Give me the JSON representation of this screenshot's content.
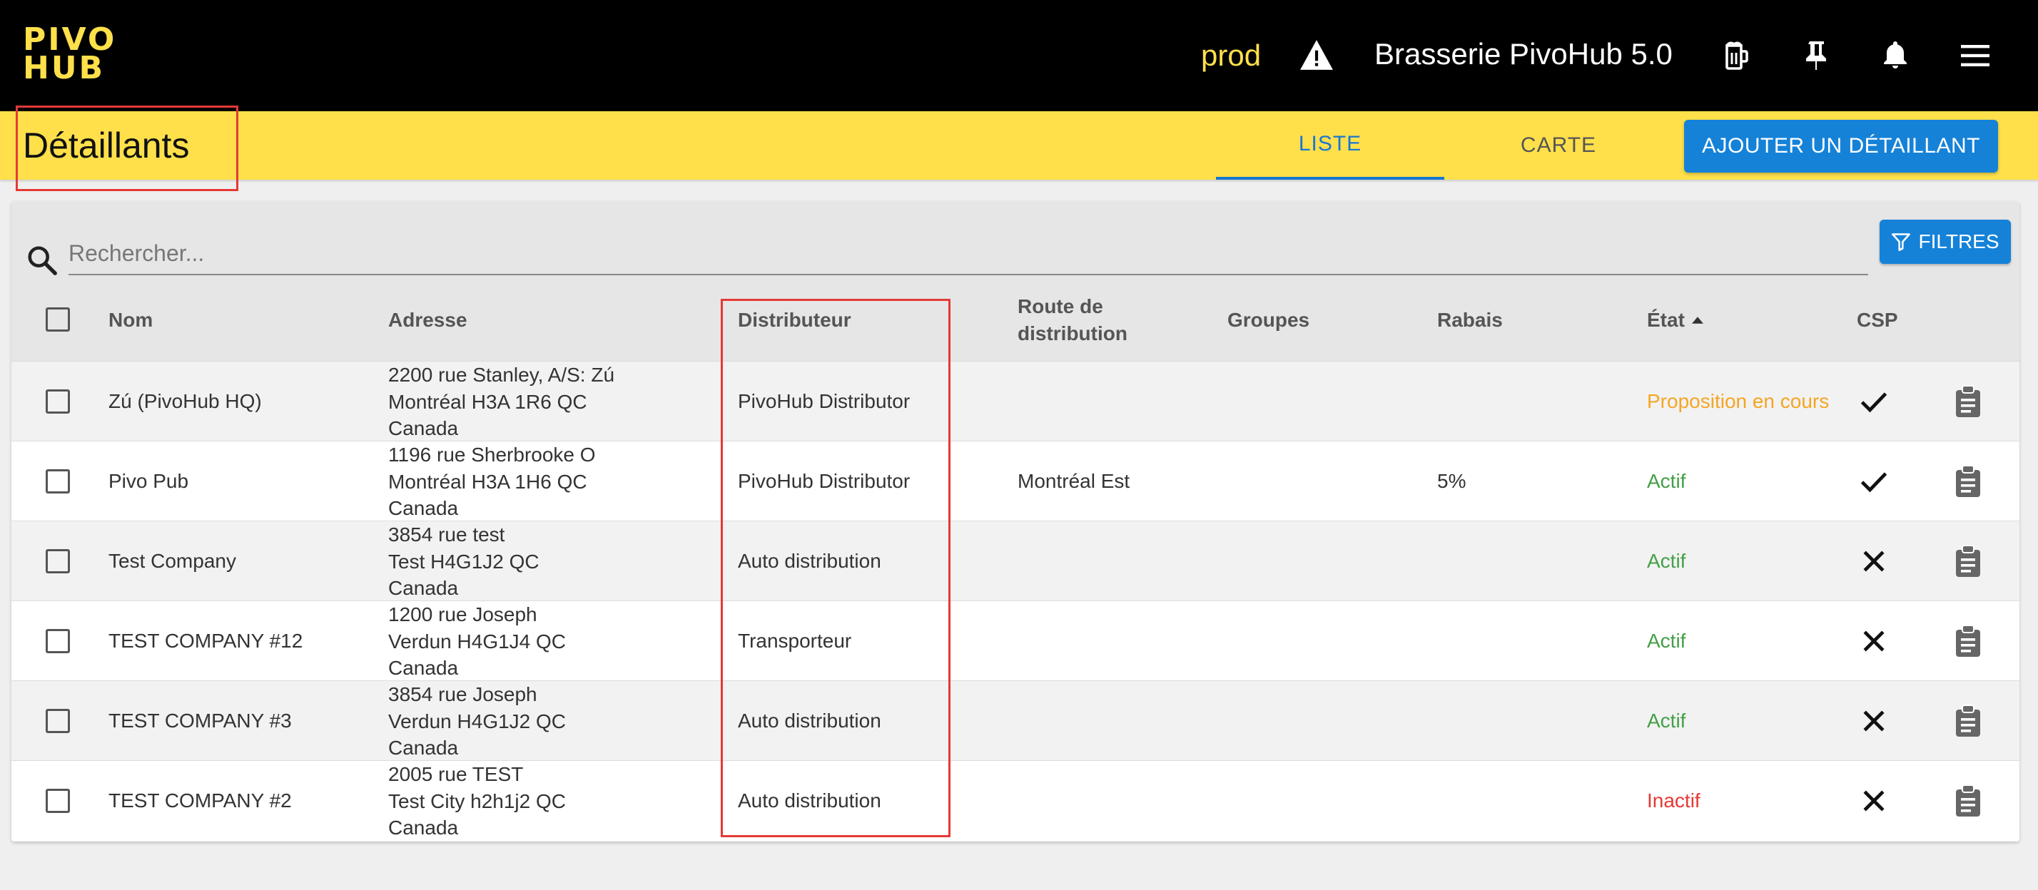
{
  "topbar": {
    "logo_line1": "PIVO",
    "logo_line2": "HUB",
    "env": "prod",
    "brewery": "Brasserie PivoHub 5.0",
    "icons": [
      "warning-icon",
      "beer-icon",
      "pin-icon",
      "bell-icon",
      "menu-icon"
    ]
  },
  "header": {
    "title": "Détaillants",
    "tabs": [
      {
        "label": "LISTE",
        "active": true
      },
      {
        "label": "CARTE",
        "active": false
      }
    ],
    "add_button": "AJOUTER UN DÉTAILLANT"
  },
  "search": {
    "placeholder": "Rechercher...",
    "filters_label": "FILTRES"
  },
  "table": {
    "columns": {
      "name": "Nom",
      "address": "Adresse",
      "distributor": "Distributeur",
      "route_line1": "Route de",
      "route_line2": "distribution",
      "groups": "Groupes",
      "discount": "Rabais",
      "state": "État",
      "csp": "CSP"
    },
    "sort": {
      "column": "state",
      "direction": "ascending"
    },
    "rows": [
      {
        "name": "Zú (PivoHub HQ)",
        "address": [
          "2200 rue Stanley, A/S: Zú",
          "Montréal H3A 1R6 QC",
          "Canada"
        ],
        "distributor": "PivoHub Distributor",
        "route": "",
        "groups": "",
        "discount": "",
        "state": "Proposition en cours",
        "state_color": "#f5a524",
        "csp": true
      },
      {
        "name": "Pivo Pub",
        "address": [
          "1196 rue Sherbrooke O",
          "Montréal H3A 1H6 QC",
          "Canada"
        ],
        "distributor": "PivoHub Distributor",
        "route": "Montréal Est",
        "groups": "",
        "discount": "5%",
        "state": "Actif",
        "state_color": "#43a047",
        "csp": true
      },
      {
        "name": "Test Company",
        "address": [
          "3854 rue test",
          "Test H4G1J2 QC",
          "Canada"
        ],
        "distributor": "Auto distribution",
        "route": "",
        "groups": "",
        "discount": "",
        "state": "Actif",
        "state_color": "#43a047",
        "csp": false
      },
      {
        "name": "TEST COMPANY #12",
        "address": [
          "1200 rue Joseph",
          "Verdun H4G1J4 QC",
          "Canada"
        ],
        "distributor": "Transporteur",
        "route": "",
        "groups": "",
        "discount": "",
        "state": "Actif",
        "state_color": "#43a047",
        "csp": false
      },
      {
        "name": "TEST COMPANY #3",
        "address": [
          "3854 rue Joseph",
          "Verdun H4G1J2 QC",
          "Canada"
        ],
        "distributor": "Auto distribution",
        "route": "",
        "groups": "",
        "discount": "",
        "state": "Actif",
        "state_color": "#43a047",
        "csp": false
      },
      {
        "name": "TEST COMPANY #2",
        "address": [
          "2005 rue TEST",
          "Test City h2h1j2 QC",
          "Canada"
        ],
        "distributor": "Auto distribution",
        "route": "",
        "groups": "",
        "discount": "",
        "state": "Inactif",
        "state_color": "#e53935",
        "csp": false
      }
    ]
  },
  "colors": {
    "brand_yellow": "#ffe04a",
    "primary_blue": "#1582d8",
    "highlight_red": "#e53935"
  }
}
